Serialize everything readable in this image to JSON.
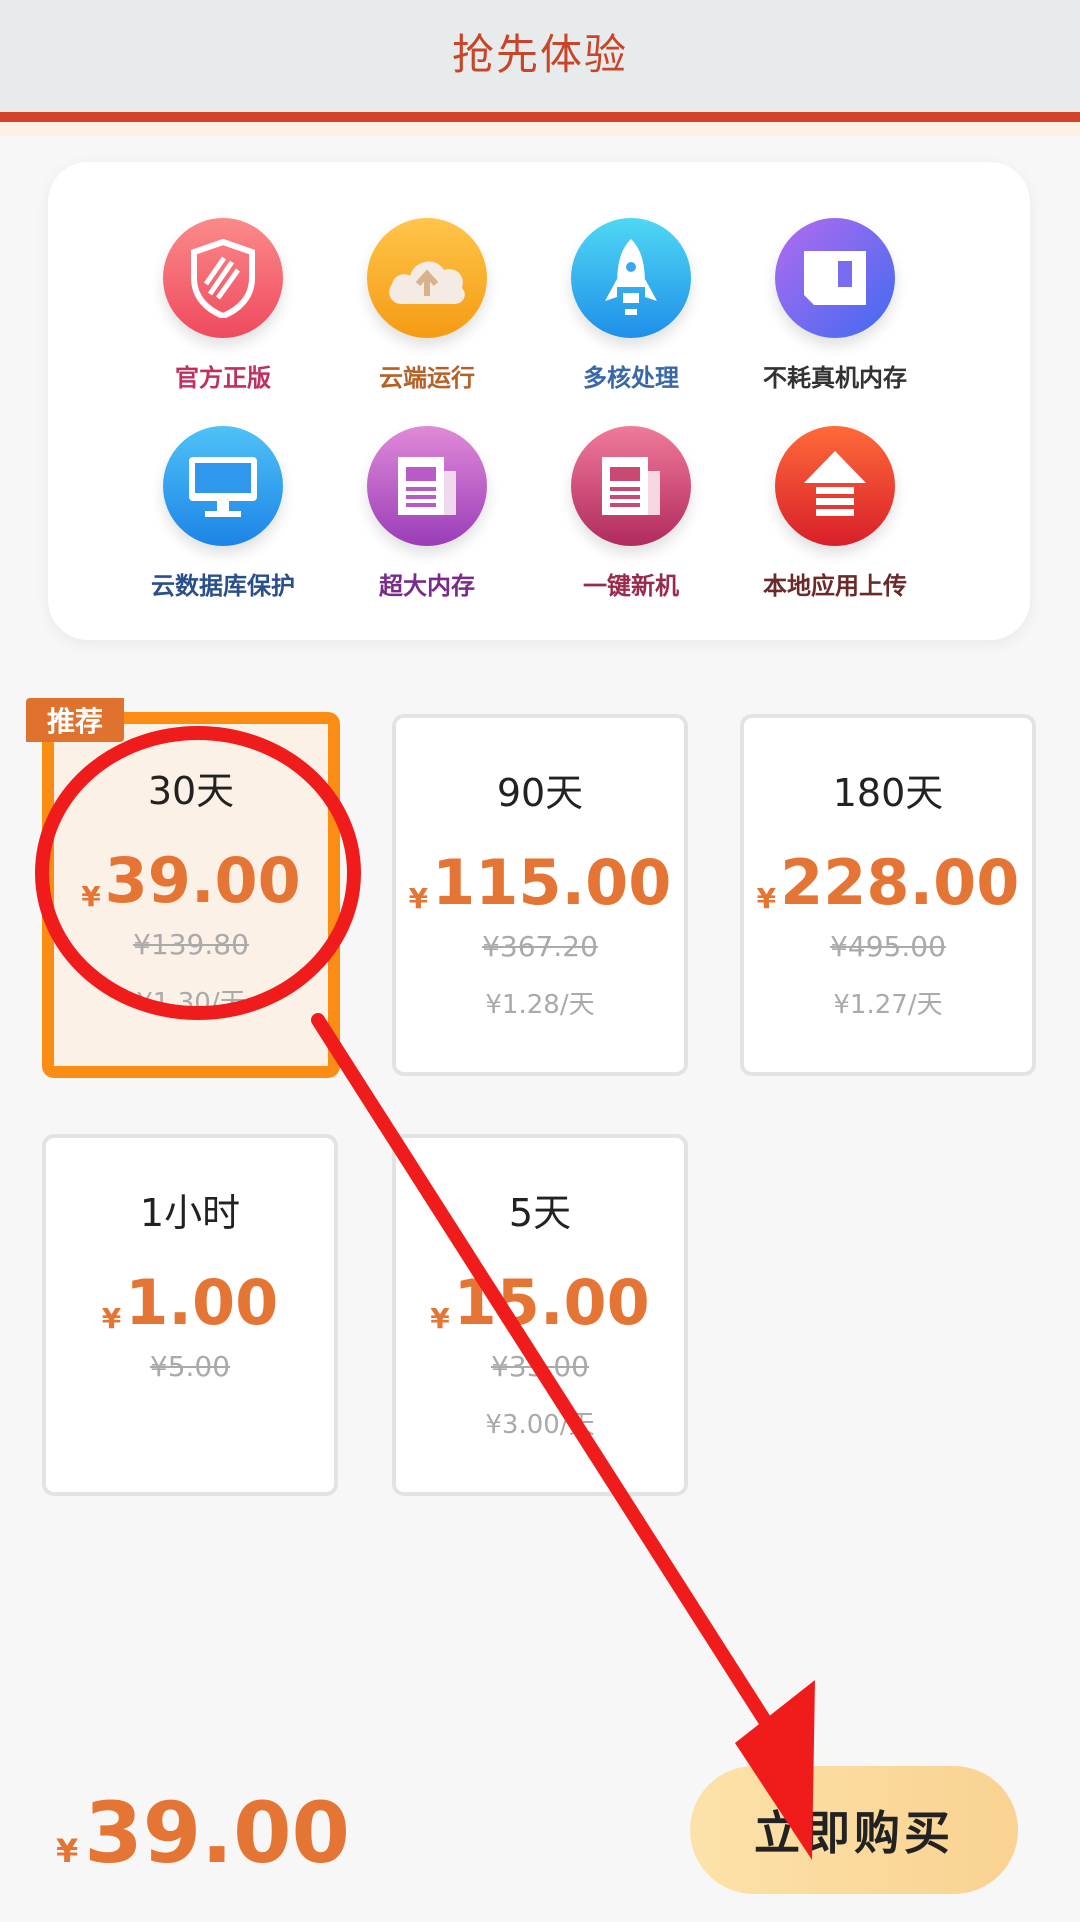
{
  "header": {
    "title": "抢先体验"
  },
  "features": [
    {
      "label": "官方正版",
      "icon": "shield-icon",
      "color_top": "#fb8a8a",
      "color_bottom": "#ef4a5e",
      "label_color": "#c0305a"
    },
    {
      "label": "云端运行",
      "icon": "cloud-upload-icon",
      "color_top": "#ffc54a",
      "color_bottom": "#f59b14",
      "label_color": "#b4612a"
    },
    {
      "label": "多核处理",
      "icon": "rocket-icon",
      "color_top": "#4fd8f4",
      "color_bottom": "#1f8fe8",
      "label_color": "#3a67a8"
    },
    {
      "label": "不耗真机内存",
      "icon": "sd-card-icon",
      "color_top": "#b36bf0",
      "color_bottom": "#3f6bf0",
      "label_color": "#333333"
    },
    {
      "label": "云数据库保护",
      "icon": "monitor-icon",
      "color_top": "#4fc2f7",
      "color_bottom": "#1c84e6",
      "label_color": "#2a4f8a"
    },
    {
      "label": "超大内存",
      "icon": "newspaper-icon",
      "color_top": "#e08ad8",
      "color_bottom": "#9a3db8",
      "label_color": "#7a2a8a"
    },
    {
      "label": "一键新机",
      "icon": "newspaper-icon",
      "color_top": "#f07a9a",
      "color_bottom": "#b02a5e",
      "label_color": "#9a2a4a"
    },
    {
      "label": "本地应用上传",
      "icon": "upload-arrow-icon",
      "color_top": "#ff6a3a",
      "color_bottom": "#d81f2a",
      "label_color": "#6a2a2a"
    }
  ],
  "badge": "推荐",
  "plans": [
    {
      "duration": "30天",
      "currency": "¥",
      "price": "39.00",
      "original": "¥139.80",
      "per_day": "¥1.30/天",
      "selected": true
    },
    {
      "duration": "90天",
      "currency": "¥",
      "price": "115.00",
      "original": "¥367.20",
      "per_day": "¥1.28/天",
      "selected": false
    },
    {
      "duration": "180天",
      "currency": "¥",
      "price": "228.00",
      "original": "¥495.00",
      "per_day": "¥1.27/天",
      "selected": false
    },
    {
      "duration": "1小时",
      "currency": "¥",
      "price": "1.00",
      "original": "¥5.00",
      "per_day": "",
      "selected": false
    },
    {
      "duration": "5天",
      "currency": "¥",
      "price": "15.00",
      "original": "¥35.00",
      "per_day": "¥3.00/天",
      "selected": false
    }
  ],
  "footer": {
    "currency": "¥",
    "total": "39.00",
    "buy_label": "立即购买"
  },
  "colors": {
    "accent": "#e57535",
    "selected_border": "#fb8c14",
    "annotation_red": "#f01c1c"
  }
}
